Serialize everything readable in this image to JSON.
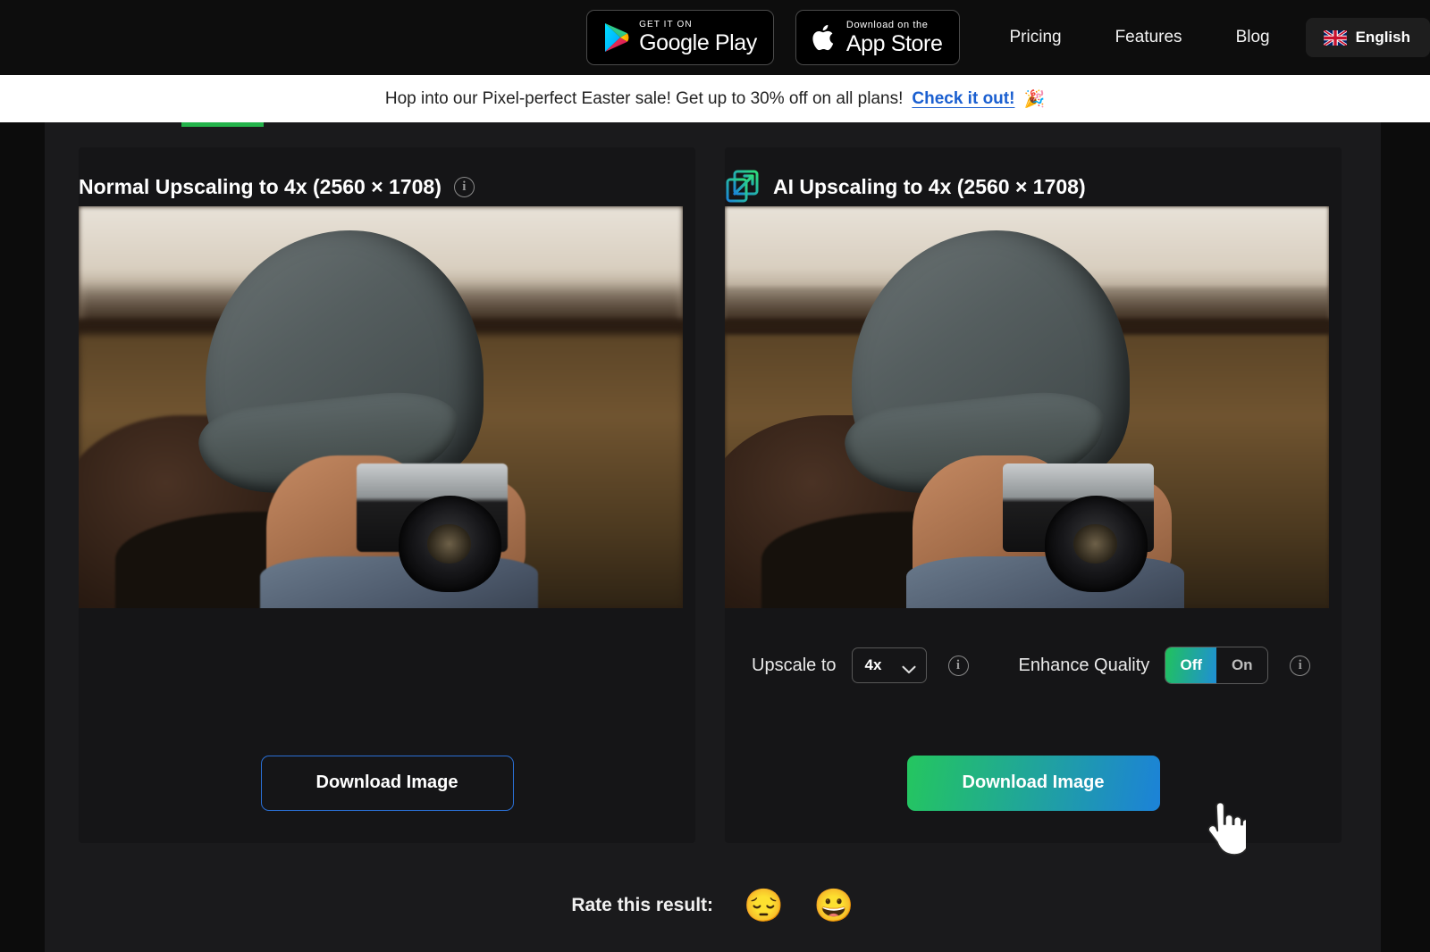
{
  "topbar": {
    "google_play": {
      "sub": "GET IT ON",
      "main": "Google Play",
      "icon": "google-play-icon"
    },
    "app_store": {
      "sub": "Download on the",
      "main": "App Store",
      "icon": "apple-icon"
    },
    "nav": [
      {
        "label": "Pricing"
      },
      {
        "label": "Features"
      },
      {
        "label": "Blog"
      }
    ],
    "language": {
      "label": "English",
      "flag": "uk-flag-icon"
    }
  },
  "banner": {
    "text": "Hop into our Pixel-perfect Easter sale! Get up to 30% off on all plans!",
    "link": "Check it out!",
    "emoji": "🎉"
  },
  "cards": {
    "normal": {
      "title": "Normal Upscaling to 4x (2560 × 1708)",
      "info_icon": "info-icon",
      "download_label": "Download Image"
    },
    "ai": {
      "title": "AI Upscaling to 4x (2560 × 1708)",
      "icon": "ai-upscale-icon",
      "download_label": "Download Image",
      "controls": {
        "upscale_label": "Upscale to",
        "upscale_value": "4x",
        "upscale_info_icon": "info-icon",
        "enhance_label": "Enhance Quality",
        "enhance_options": [
          "Off",
          "On"
        ],
        "enhance_selected": "Off",
        "enhance_info_icon": "info-icon"
      }
    }
  },
  "rate": {
    "label": "Rate this result:",
    "sad_emoji": "😔",
    "happy_emoji": "😀"
  },
  "colors": {
    "accent_green": "#24c65f",
    "accent_blue": "#1c82d8",
    "banner_link": "#1a5fd0",
    "tab_indicator": "#24b34b",
    "page_bg": "#0c0c0c",
    "content_bg": "#1a1a1c",
    "card_bg": "#151517"
  }
}
